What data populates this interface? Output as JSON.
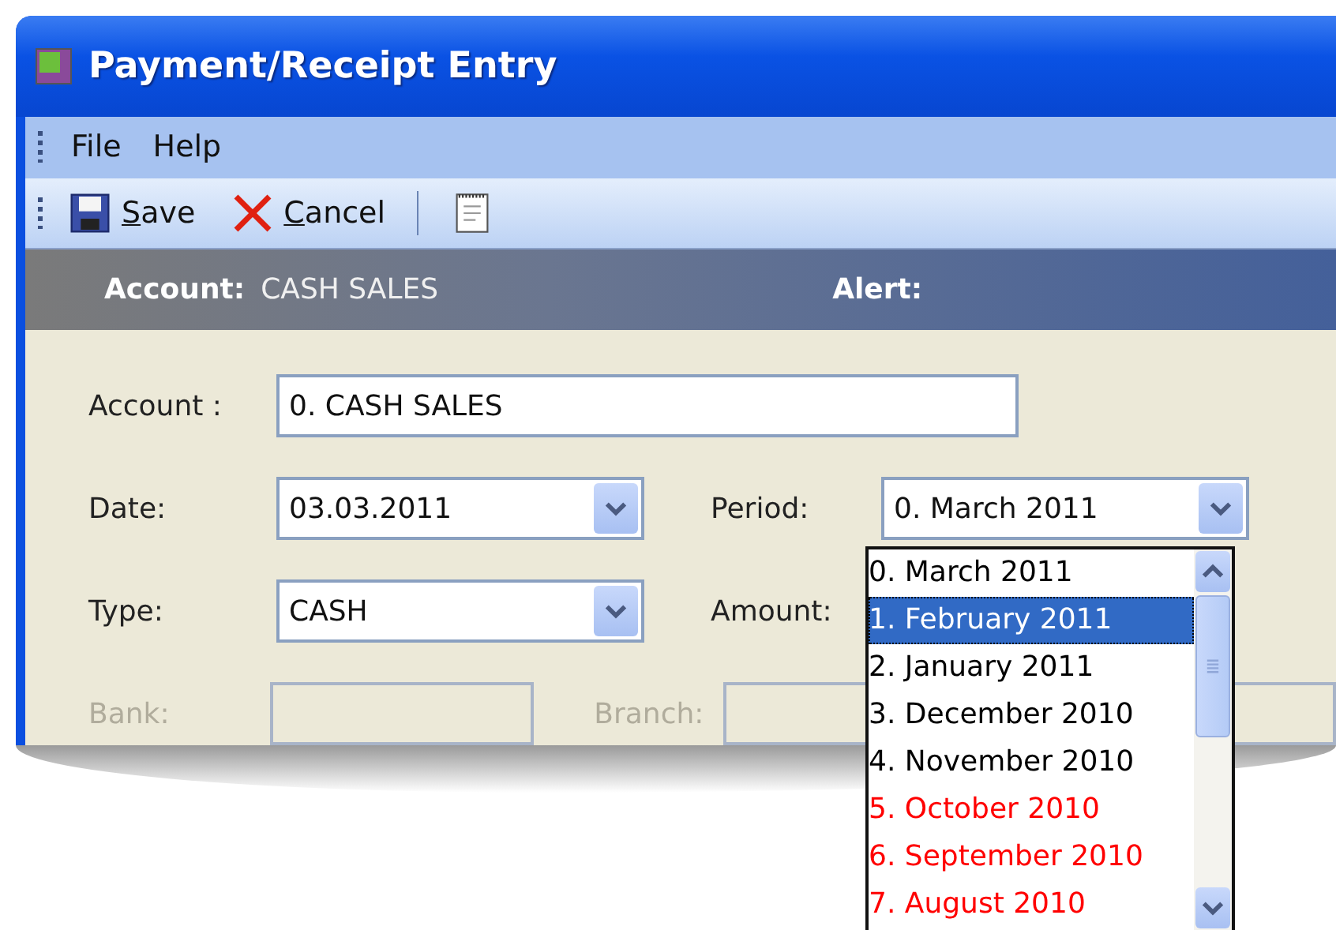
{
  "window": {
    "title": "Payment/Receipt Entry"
  },
  "menu": [
    "File",
    "Help"
  ],
  "toolbar": [
    {
      "kind": "save",
      "label": "Save"
    },
    {
      "kind": "cancel",
      "label": "Cancel"
    },
    {
      "kind": "separator"
    },
    {
      "kind": "notes"
    }
  ],
  "banner": {
    "account_label": "Account:",
    "account_value": "CASH SALES",
    "alert_label": "Alert:"
  },
  "form": {
    "account": {
      "label": "Account :",
      "value": "0. CASH SALES"
    },
    "date": {
      "label": "Date:",
      "value": "03.03.2011"
    },
    "period": {
      "label": "Period:",
      "value": "0. March 2011"
    },
    "type": {
      "label": "Type:",
      "value": "CASH"
    },
    "amount": {
      "label": "Amount:"
    },
    "bank": {
      "label": "Bank:",
      "disabled": true
    },
    "branch": {
      "label": "Branch:",
      "disabled": true
    }
  },
  "period_list": {
    "items": [
      {
        "label": "0. March 2011",
        "selected": false,
        "color": "#000000"
      },
      {
        "label": "1. February 2011",
        "selected": true,
        "color": "#000000"
      },
      {
        "label": "2. January 2011",
        "selected": false,
        "color": "#000000"
      },
      {
        "label": "3. December 2010",
        "selected": false,
        "color": "#000000"
      },
      {
        "label": "4. November 2010",
        "selected": false,
        "color": "#000000"
      },
      {
        "label": "5. October 2010",
        "selected": false,
        "color": "#ff0000"
      },
      {
        "label": "6. September 2010",
        "selected": false,
        "color": "#ff0000"
      },
      {
        "label": "7. August 2010",
        "selected": false,
        "color": "#ff0000"
      }
    ]
  }
}
